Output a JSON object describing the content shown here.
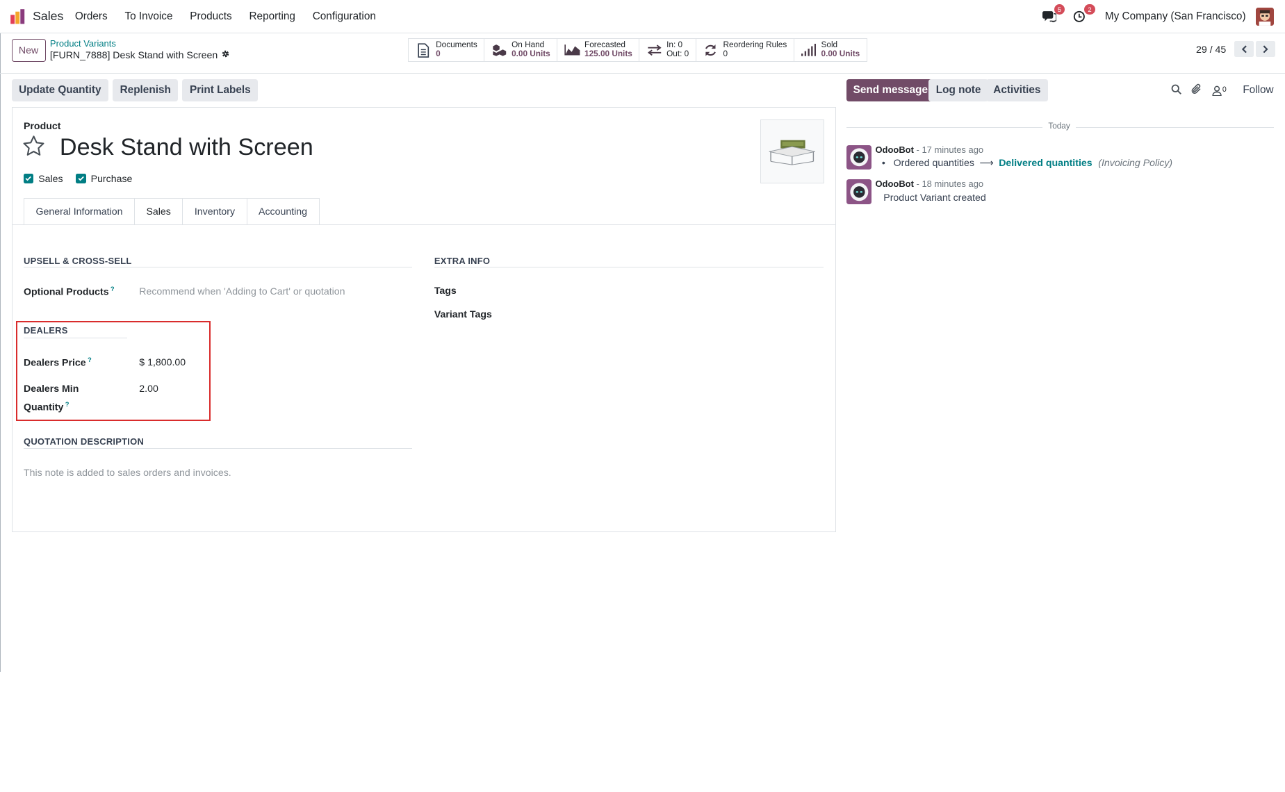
{
  "navbar": {
    "app_name": "Sales",
    "menu": [
      "Orders",
      "To Invoice",
      "Products",
      "Reporting",
      "Configuration"
    ],
    "messages_badge": "5",
    "activities_badge": "2",
    "company": "My Company (San Francisco)"
  },
  "control_panel": {
    "new_label": "New",
    "breadcrumb_parent": "Product Variants",
    "breadcrumb_current": "[FURN_7888] Desk Stand with Screen",
    "smart_buttons": [
      {
        "icon": "file-text-icon",
        "label": "Documents",
        "value": "0"
      },
      {
        "icon": "cubes-icon",
        "label": "On Hand",
        "value": "0.00 Units"
      },
      {
        "icon": "area-chart-icon",
        "label": "Forecasted",
        "value": "125.00 Units"
      },
      {
        "icon": "exchange-icon",
        "label": "In: 0",
        "value": "Out: 0"
      },
      {
        "icon": "refresh-icon",
        "label": "Reordering Rules",
        "value": "0"
      },
      {
        "icon": "signal-icon",
        "label": "Sold",
        "value": "0.00 Units"
      }
    ],
    "pager": "29 / 45"
  },
  "actions": [
    "Update Quantity",
    "Replenish",
    "Print Labels"
  ],
  "form": {
    "product_label": "Product",
    "name": "Desk Stand with Screen",
    "checkboxes": [
      {
        "label": "Sales",
        "checked": true
      },
      {
        "label": "Purchase",
        "checked": true
      }
    ],
    "tabs": [
      "General Information",
      "Sales",
      "Inventory",
      "Accounting"
    ],
    "active_tab": "Sales",
    "upsell": {
      "title": "UPSELL & CROSS-SELL",
      "optional_products_label": "Optional Products",
      "optional_products_placeholder": "Recommend when 'Adding to Cart' or quotation"
    },
    "extra_info": {
      "title": "EXTRA INFO",
      "tags_label": "Tags",
      "variant_tags_label": "Variant Tags"
    },
    "dealers": {
      "title": "DEALERS",
      "price_label": "Dealers Price",
      "price_value": "$ 1,800.00",
      "min_qty_label_1": "Dealers Min",
      "min_qty_label_2": "Quantity",
      "min_qty_value": "2.00"
    },
    "quotation": {
      "title": "QUOTATION DESCRIPTION",
      "placeholder": "This note is added to sales orders and invoices."
    },
    "help_mark": "?"
  },
  "chatter": {
    "send_message": "Send message",
    "log_note": "Log note",
    "activities": "Activities",
    "followers_count": "0",
    "follow": "Follow",
    "date_separator": "Today",
    "messages": [
      {
        "author": "OdooBot",
        "time": "- 17 minutes ago",
        "old_value": "Ordered quantities",
        "new_value": "Delivered quantities",
        "field": "(Invoicing Policy)"
      },
      {
        "author": "OdooBot",
        "time": "- 18 minutes ago",
        "body": "Product Variant created"
      }
    ]
  },
  "colors": {
    "brand": "#714b67",
    "link": "#017e84",
    "highlight_border": "#d92c2c"
  }
}
